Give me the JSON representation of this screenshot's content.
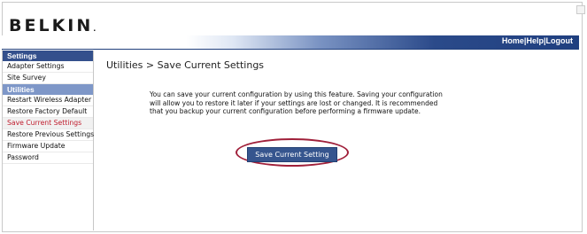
{
  "header": {
    "logo_text": "BELKIN",
    "logo_dot": ".",
    "links": {
      "home": "Home",
      "separator": "|",
      "help": "Help",
      "logout": "Logout"
    }
  },
  "sidebar": {
    "settings_heading": "Settings",
    "settings_items": [
      {
        "label": "Adapter Settings"
      },
      {
        "label": "Site Survey"
      }
    ],
    "utilities_heading": "Utilities",
    "utilities_items": [
      {
        "label": "Restart Wireless Adapter"
      },
      {
        "label": "Restore Factory Default"
      },
      {
        "label": "Save Current Settings",
        "active": true
      },
      {
        "label": "Restore Previous Settings"
      },
      {
        "label": "Firmware Update"
      },
      {
        "label": "Password"
      }
    ]
  },
  "main": {
    "title": "Utilities > Save Current Settings",
    "description": "You can save your current configuration by using this feature. Saving your configuration will allow you to restore it later if your settings are lost or changed. It is recommended that you backup your current configuration before performing a firmware update.",
    "button_label": "Save Current Setting"
  },
  "colors": {
    "banner": "#203f7c",
    "active_link": "#c01d2e",
    "highlight_circle": "#a0203a"
  }
}
